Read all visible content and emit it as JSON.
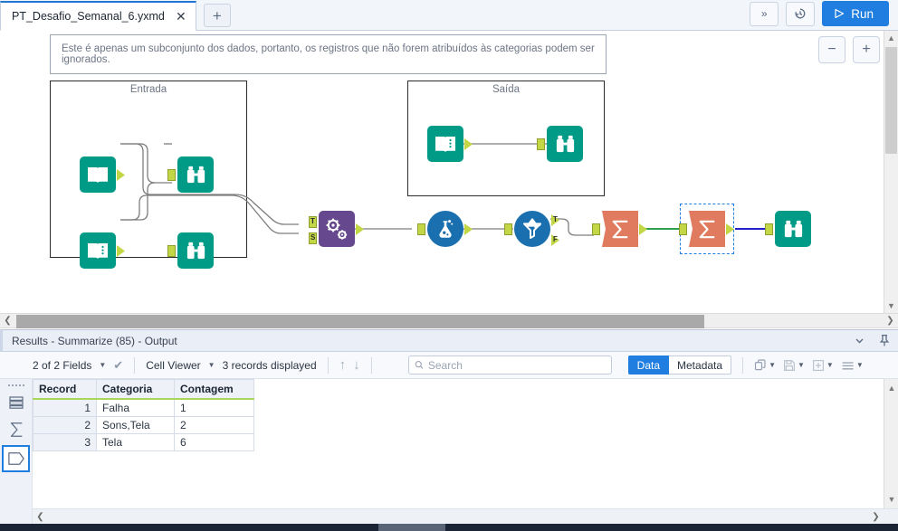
{
  "tab": {
    "title": "PT_Desafio_Semanal_6.yxmd",
    "close_label": "✕",
    "add_label": "+"
  },
  "toolbar": {
    "overflow_label": "»",
    "history_icon": "history-icon",
    "run_label": "Run"
  },
  "canvas": {
    "comment": "Este é apenas um subconjunto dos dados, portanto, os registros que não forem atribuídos às categorias podem ser ignorados.",
    "containers": [
      {
        "title": "Entrada"
      },
      {
        "title": "Saída"
      }
    ],
    "zoom_out_label": "−",
    "zoom_in_label": "+",
    "anchors": {
      "t": "T",
      "f": "F",
      "s": "S"
    },
    "tools": [
      {
        "name": "input-data-tool",
        "type": "input"
      },
      {
        "name": "browse-tool",
        "type": "browse"
      },
      {
        "name": "find-replace-tool",
        "type": "findreplace"
      },
      {
        "name": "data-cleansing-tool",
        "type": "cleanse"
      },
      {
        "name": "filter-tool",
        "type": "filter"
      },
      {
        "name": "summarize-tool",
        "type": "summarize"
      }
    ]
  },
  "results": {
    "title": "Results - Summarize (85) - Output",
    "collapse_icon": "chevron-down-icon",
    "pin_icon": "pin-icon",
    "fields_label": "2 of 2 Fields",
    "viewer_label": "Cell Viewer",
    "records_label": "3 records displayed",
    "search_placeholder": "Search",
    "search_value": "",
    "data_tab": "Data",
    "metadata_tab": "Metadata",
    "active_tab": "Data",
    "table": {
      "columns": [
        "Record",
        "Categoria",
        "Contagem"
      ],
      "rows": [
        [
          "1",
          "Falha",
          "1"
        ],
        [
          "2",
          "Sons,Tela",
          "2"
        ],
        [
          "3",
          "Tela",
          "6"
        ]
      ]
    }
  },
  "colors": {
    "accent": "#1f7ee0",
    "teal": "#009b87",
    "purple": "#66488f",
    "blue_tool": "#1a6faf",
    "summarize": "#e07b5f",
    "anchor": "#c3d646",
    "header_underline": "#a8d65b"
  }
}
